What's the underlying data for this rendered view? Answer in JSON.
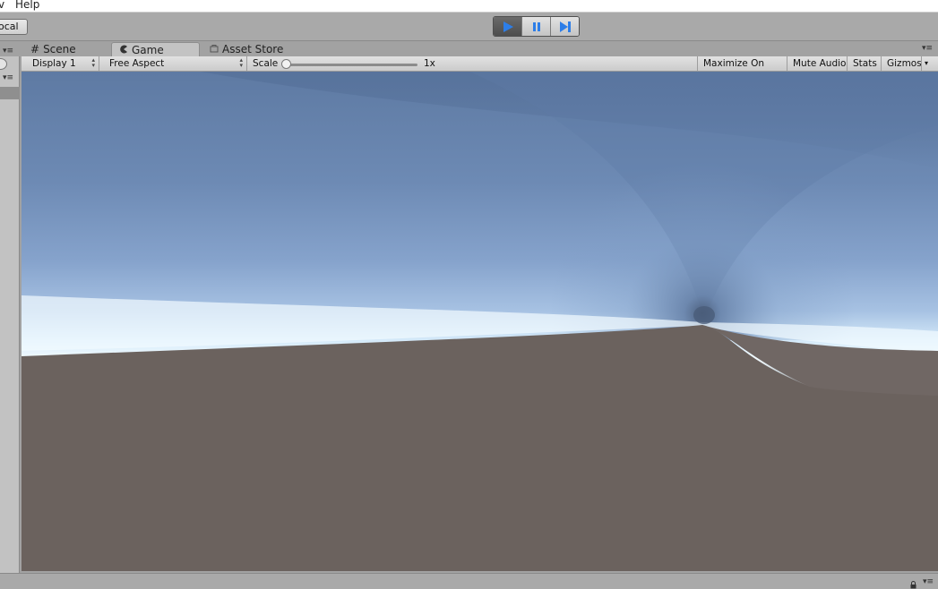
{
  "menu": {
    "partial_item": "v",
    "help": "Help"
  },
  "toolbar": {
    "pivot_mode": "ocal"
  },
  "tabs": [
    {
      "label": "Scene",
      "icon": "grid-icon"
    },
    {
      "label": "Game",
      "icon": "pacman-icon"
    },
    {
      "label": "Asset Store",
      "icon": "store-icon"
    }
  ],
  "game_toolbar": {
    "display": "Display 1",
    "aspect": "Free Aspect",
    "scale_label": "Scale",
    "scale_value": "1x",
    "scale_fraction": 0.0,
    "maximize": "Maximize On Play",
    "mute": "Mute Audio",
    "stats": "Stats",
    "gizmos": "Gizmos"
  },
  "play_controls": {
    "state": "playing",
    "accent": "#2d7ee8"
  },
  "colors": {
    "sky_top": "#5d7aa3",
    "sky_mid": "#87a3c9",
    "horizon": "#f4fbff",
    "ground": "#6a615c"
  }
}
